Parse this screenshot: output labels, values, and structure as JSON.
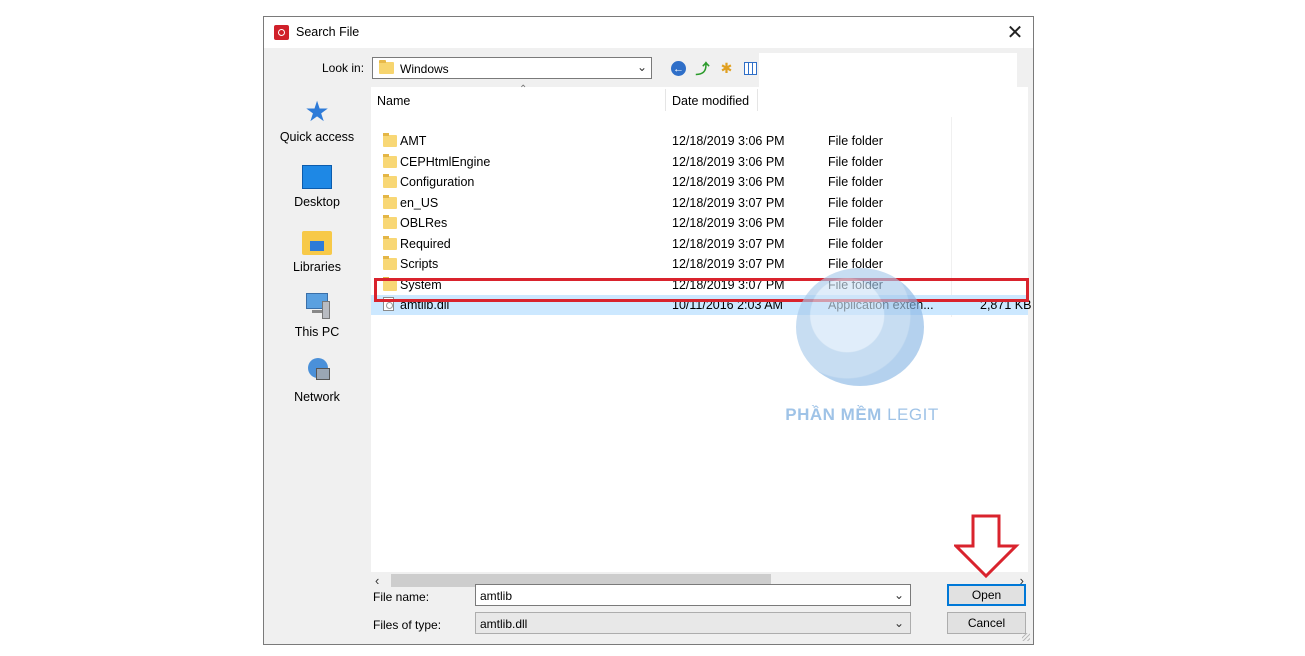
{
  "dialog": {
    "title": "Search File",
    "close_glyph": "✕"
  },
  "lookin": {
    "label": "Look in:",
    "value": "Windows"
  },
  "sidebar": {
    "items": [
      {
        "label": "Quick access",
        "icon": "star-icon"
      },
      {
        "label": "Desktop",
        "icon": "desktop-icon"
      },
      {
        "label": "Libraries",
        "icon": "libraries-icon"
      },
      {
        "label": "This PC",
        "icon": "computer-icon"
      },
      {
        "label": "Network",
        "icon": "network-icon"
      }
    ]
  },
  "columns": {
    "name": "Name",
    "date": "Date modified"
  },
  "files": [
    {
      "name": "AMT",
      "date": "12/18/2019 3:06 PM",
      "type": "File folder",
      "size": ""
    },
    {
      "name": "CEPHtmlEngine",
      "date": "12/18/2019 3:06 PM",
      "type": "File folder",
      "size": ""
    },
    {
      "name": "Configuration",
      "date": "12/18/2019 3:06 PM",
      "type": "File folder",
      "size": ""
    },
    {
      "name": "en_US",
      "date": "12/18/2019 3:07 PM",
      "type": "File folder",
      "size": ""
    },
    {
      "name": "OBLRes",
      "date": "12/18/2019 3:06 PM",
      "type": "File folder",
      "size": ""
    },
    {
      "name": "Required",
      "date": "12/18/2019 3:07 PM",
      "type": "File folder",
      "size": ""
    },
    {
      "name": "Scripts",
      "date": "12/18/2019 3:07 PM",
      "type": "File folder",
      "size": ""
    },
    {
      "name": "System",
      "date": "12/18/2019 3:07 PM",
      "type": "File folder",
      "size": ""
    },
    {
      "name": "amtlib.dll",
      "date": "10/11/2016 2:03 AM",
      "type": "Application exten...",
      "size": "2,871 KB"
    }
  ],
  "filename": {
    "label": "File name:",
    "value": "amtlib"
  },
  "filetype": {
    "label": "Files of type:",
    "value": "amtlib.dll"
  },
  "buttons": {
    "open": "Open",
    "cancel": "Cancel"
  },
  "watermark": {
    "bold": "PHẦN MỀM",
    "thin": "LEGIT"
  },
  "colors": {
    "selection": "#cce8ff",
    "highlight": "#d9232d",
    "accent": "#0078d7"
  }
}
